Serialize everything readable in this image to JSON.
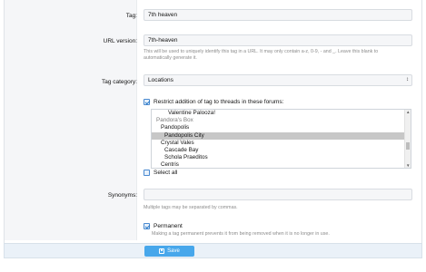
{
  "tag": {
    "label": "Tag:",
    "value": "7th heaven"
  },
  "url_version": {
    "label": "URL version:",
    "value": "7th-heaven",
    "hint_line1": "This will be used to uniquely identify this tag in a URL. It may only contain a-z, 0-9, - and _. Leave this blank to",
    "hint_line2": "automatically generate it."
  },
  "tag_category": {
    "label": "Tag category:",
    "selected": "Locations"
  },
  "restrict": {
    "label": "Restrict addition of tag to threads in these forums:",
    "checked": true
  },
  "forum_list": [
    {
      "text": "Valentine Palooza!",
      "indent": 3,
      "type": "forum"
    },
    {
      "text": "Pandora's Box",
      "indent": 0,
      "type": "group"
    },
    {
      "text": "Pandopolis",
      "indent": 1,
      "type": "forum"
    },
    {
      "text": "Pandopolis City",
      "indent": 2,
      "type": "forum",
      "selected": true
    },
    {
      "text": "Crystal Vales",
      "indent": 1,
      "type": "forum"
    },
    {
      "text": "Cascade Bay",
      "indent": 2,
      "type": "forum"
    },
    {
      "text": "Schola Praeditos",
      "indent": 2,
      "type": "forum"
    },
    {
      "text": "Centris",
      "indent": 1,
      "type": "forum"
    }
  ],
  "select_all": {
    "label": "Select all",
    "checked": false
  },
  "synonyms": {
    "label": "Synonyms:",
    "value": "",
    "hint": "Multiple tags may be separated by commas."
  },
  "permanent": {
    "label": "Permanent",
    "checked": true,
    "hint": "Making a tag permanent prevents it from being removed when it is no longer in use."
  },
  "footer": {
    "save_label": "Save",
    "save_icon": "floppy-disk-icon"
  },
  "colors": {
    "accent": "#47a7eb",
    "selected_row": "#c7c7c7",
    "input_bg": "#f5f6f8"
  }
}
